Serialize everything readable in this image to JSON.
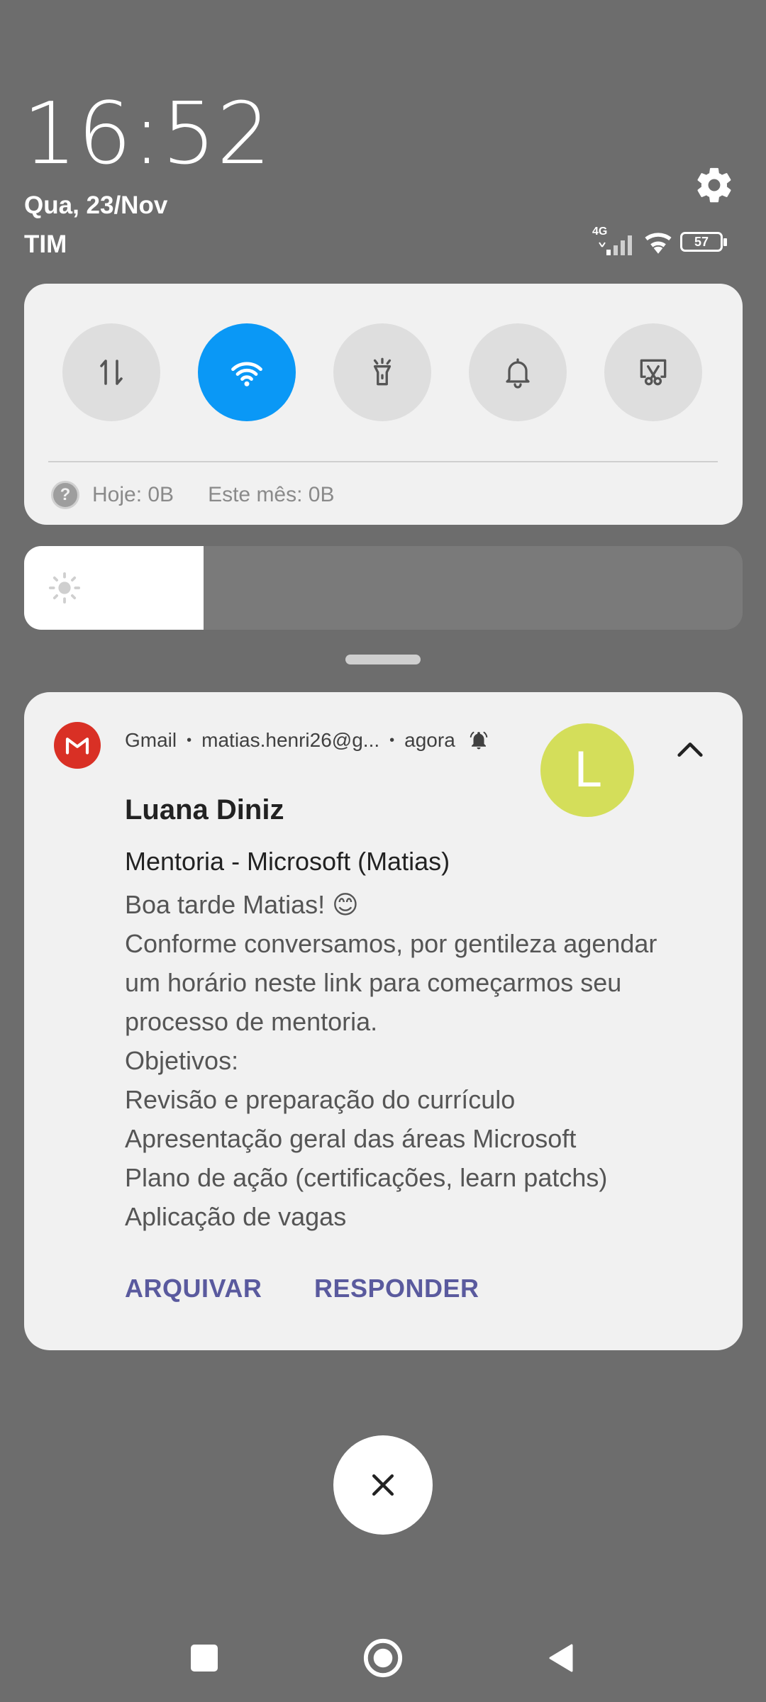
{
  "header": {
    "time": "16:52",
    "date": "Qua, 23/Nov",
    "carrier": "TIM",
    "network_type": "4G",
    "battery": "57"
  },
  "quick_settings": {
    "toggles": [
      {
        "name": "mobile-data",
        "icon": "data-arrows-icon",
        "active": false
      },
      {
        "name": "wifi",
        "icon": "wifi-icon",
        "active": true
      },
      {
        "name": "flashlight",
        "icon": "flashlight-icon",
        "active": false
      },
      {
        "name": "sound",
        "icon": "bell-icon",
        "active": false
      },
      {
        "name": "screenshot",
        "icon": "scissors-screen-icon",
        "active": false
      }
    ],
    "data_today": "Hoje: 0B",
    "data_month": "Este mês: 0B",
    "active_color": "#0a98f6"
  },
  "brightness": {
    "level": 0.25
  },
  "notification": {
    "app": "Gmail",
    "account": "matias.henri26@g...",
    "time": "agora",
    "avatar_letter": "L",
    "avatar_color": "#d4de5a",
    "sender": "Luana Diniz",
    "subject": "Mentoria - Microsoft (Matias)",
    "body_lines": [
      "Boa tarde Matias! 😊",
      "Conforme conversamos, por gentileza agendar",
      "um horário neste link para começarmos seu",
      "processo de mentoria.",
      "Objetivos:",
      "Revisão e preparação do currículo",
      "Apresentação geral das áreas Microsoft",
      "Plano de ação (certificações, learn patchs)",
      "Aplicação de vagas"
    ],
    "actions": {
      "archive": "ARQUIVAR",
      "reply": "RESPONDER"
    }
  }
}
